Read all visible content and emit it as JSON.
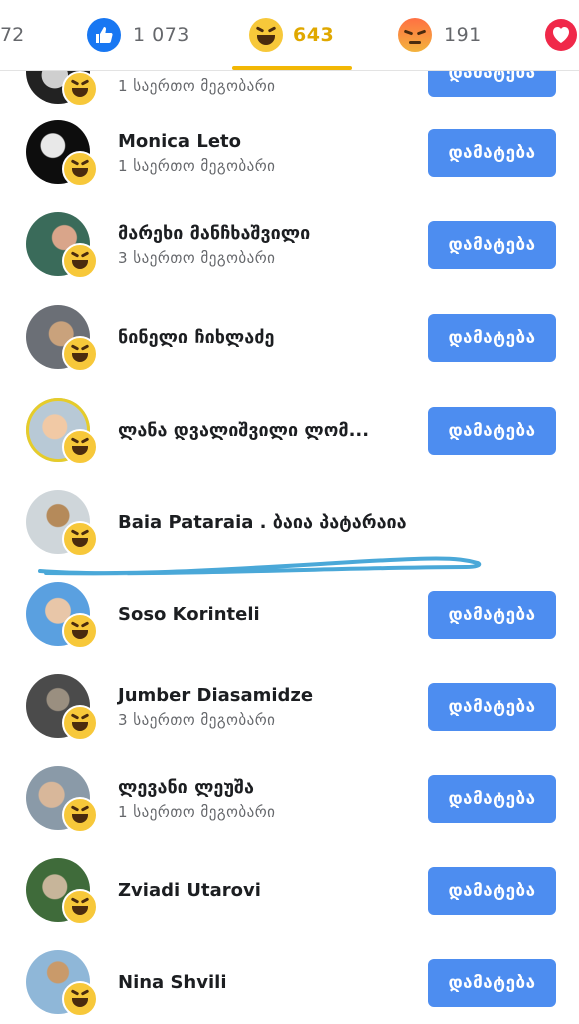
{
  "reactions_bar": {
    "tabs": [
      {
        "kind": "truncated",
        "count": "72"
      },
      {
        "kind": "like-icon",
        "count": "1 073"
      },
      {
        "kind": "haha-icon",
        "count": "643",
        "active": true
      },
      {
        "kind": "angry-icon",
        "count": "191"
      },
      {
        "kind": "love-icon",
        "count": ""
      }
    ],
    "accent_color": "#f2b705"
  },
  "people": [
    {
      "name": "",
      "mutual": "1 საერთო მეგობარი",
      "button": "დამატება",
      "avatar_colors": [
        "#222",
        "#cfcfcf"
      ]
    },
    {
      "name": "Monica Leto",
      "mutual": "1 საერთო მეგობარი",
      "button": "დამატება",
      "avatar_colors": [
        "#0d0d0d",
        "#e8e8e8"
      ]
    },
    {
      "name": "მარეხი მანჩხაშვილი",
      "mutual": "3 საერთო მეგობარი",
      "button": "დამატება",
      "avatar_colors": [
        "#3a6b5a",
        "#d9a58a"
      ]
    },
    {
      "name": "ნინელი ჩიხლაძე",
      "mutual": "",
      "button": "დამატება",
      "avatar_colors": [
        "#6b6f76",
        "#c9a27c"
      ]
    },
    {
      "name": "ლანა დვალიშვილი ლომ...",
      "mutual": "",
      "button": "დამატება",
      "avatar_colors": [
        "#b8c9d6",
        "#f1c9a5"
      ]
    },
    {
      "name": "Baia Pataraia . ბაია პატარაია",
      "mutual": "",
      "button": "",
      "avatar_colors": [
        "#cfd6da",
        "#b58a5a"
      ]
    },
    {
      "name": "Soso Korinteli",
      "mutual": "",
      "button": "დამატება",
      "avatar_colors": [
        "#5aa0e0",
        "#e8c6a8"
      ]
    },
    {
      "name": "Jumber Diasamidze",
      "mutual": "3 საერთო მეგობარი",
      "button": "დამატება",
      "avatar_colors": [
        "#4b4b4b",
        "#9a8f80"
      ]
    },
    {
      "name": "ლევანი ლეუშა",
      "mutual": "1 საერთო მეგობარი",
      "button": "დამატება",
      "avatar_colors": [
        "#8a9aa8",
        "#d8b79a"
      ]
    },
    {
      "name": "Zviadi Utarovi",
      "mutual": "",
      "button": "დამატება",
      "avatar_colors": [
        "#3f6b3a",
        "#c7b59a"
      ]
    },
    {
      "name": "Nina Shvili",
      "mutual": "",
      "button": "დამატება",
      "avatar_colors": [
        "#8fb7d8",
        "#c99a6a"
      ]
    }
  ],
  "colors": {
    "button": "#4d8df0",
    "scribble": "#4aa8d8"
  }
}
